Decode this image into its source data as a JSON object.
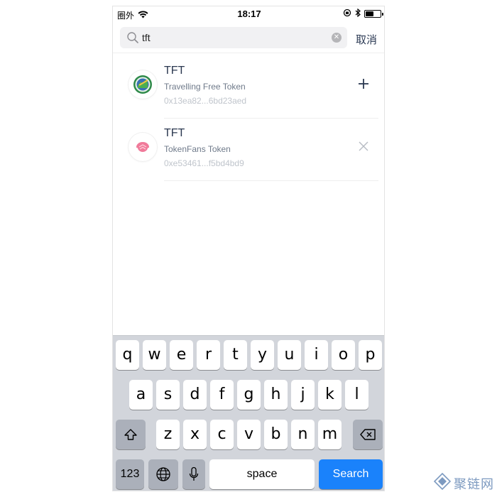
{
  "status_bar": {
    "carrier": "圈外",
    "time": "18:17"
  },
  "search": {
    "query": "tft",
    "cancel_label": "取消"
  },
  "tokens": [
    {
      "symbol": "TFT",
      "name": "Travelling Free Token",
      "address": "0x13ea82...6bd23aed",
      "action": "add"
    },
    {
      "symbol": "TFT",
      "name": "TokenFans Token",
      "address": "0xe53461...f5bd4bd9",
      "action": "remove"
    }
  ],
  "keyboard": {
    "row1": [
      "q",
      "w",
      "e",
      "r",
      "t",
      "y",
      "u",
      "i",
      "o",
      "p"
    ],
    "row2": [
      "a",
      "s",
      "d",
      "f",
      "g",
      "h",
      "j",
      "k",
      "l"
    ],
    "row3": [
      "z",
      "x",
      "c",
      "v",
      "b",
      "n",
      "m"
    ],
    "numbers_label": "123",
    "space_label": "space",
    "search_label": "Search"
  },
  "watermark": {
    "text": "聚链网"
  },
  "colors": {
    "accent": "#1a82fb",
    "title": "#2b3850",
    "keyboard_bg": "#d2d5db"
  }
}
